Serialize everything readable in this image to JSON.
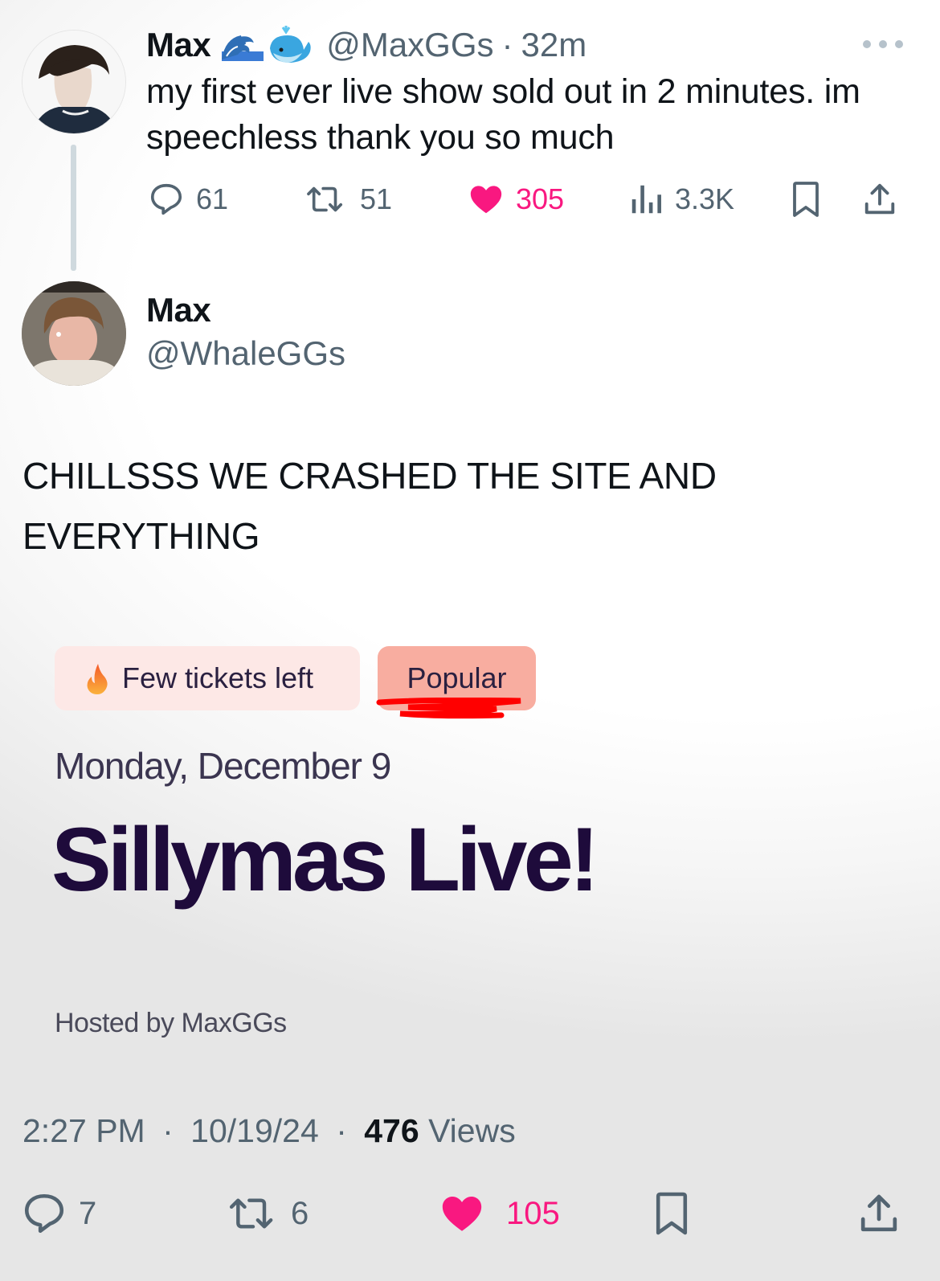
{
  "parent_tweet": {
    "name": "Max",
    "name_emojis": [
      "wave-emoji",
      "whale-emoji"
    ],
    "handle": "@MaxGGs",
    "separator": "·",
    "time": "32m",
    "text": "my first ever live show sold out in 2 minutes. im speechless thank you so much",
    "more_icon": "more-horizontal-icon",
    "actions": {
      "replies": "61",
      "retweets": "51",
      "likes": "305",
      "views": "3.3K"
    },
    "liked": true
  },
  "reply_tweet": {
    "name": "Max",
    "handle": "@WhaleGGs",
    "text": "CHILLSSS WE CRASHED THE SITE AND EVERYTHING",
    "image": {
      "badges": [
        {
          "label": "Few tickets left",
          "icon": "flame-icon"
        },
        {
          "label": "Popular"
        }
      ],
      "date": "Monday, December 9",
      "title": "Sillymas Live!",
      "host": "Hosted by MaxGGs"
    },
    "meta": {
      "time": "2:27 PM",
      "separator": "·",
      "date": "10/19/24",
      "views_count": "476",
      "views_label": "Views"
    },
    "actions": {
      "replies": "7",
      "retweets": "6",
      "likes": "105"
    },
    "liked": true
  },
  "colors": {
    "text_primary": "#0f1419",
    "text_secondary": "#536471",
    "like_pink": "#f91880",
    "thread_line": "#cfd9de",
    "event_title": "#1e0b3b",
    "badge_few_bg": "#fde8e6",
    "badge_popular_bg": "#f8ada0",
    "scribble_red": "#ff0000"
  }
}
